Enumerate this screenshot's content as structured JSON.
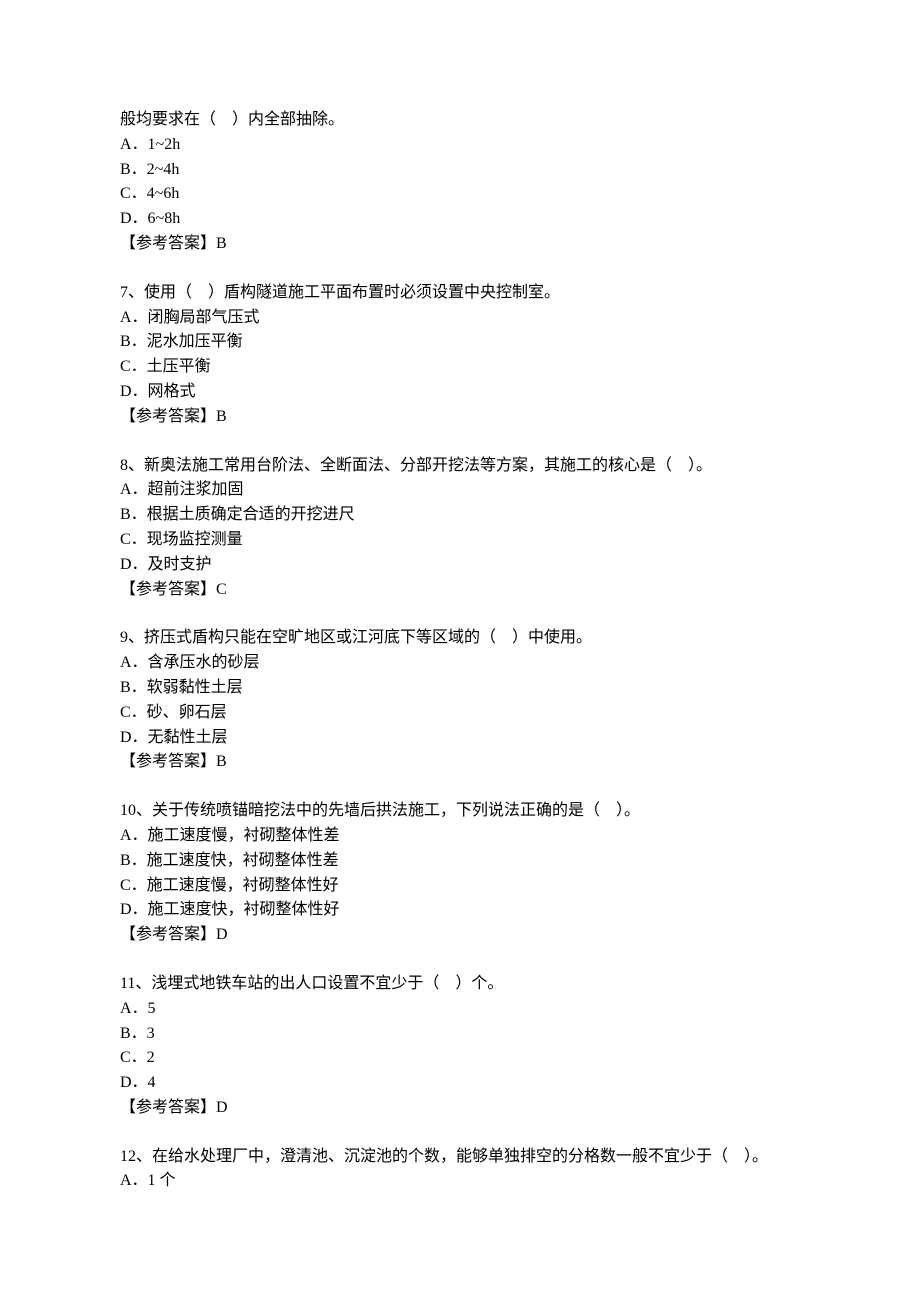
{
  "q6": {
    "stem": "般均要求在（　）内全部抽除。",
    "opts": [
      "A．1~2h",
      "B．2~4h",
      "C．4~6h",
      "D．6~8h"
    ],
    "answer": "【参考答案】B"
  },
  "q7": {
    "stem": "7、使用（　）盾构隧道施工平面布置时必须设置中央控制室。",
    "opts": [
      "A．闭胸局部气压式",
      "B．泥水加压平衡",
      "C．土压平衡",
      "D．网格式"
    ],
    "answer": "【参考答案】B"
  },
  "q8": {
    "stem": "8、新奥法施工常用台阶法、全断面法、分部开挖法等方案，其施工的核心是（　）。",
    "opts": [
      "A．超前注浆加固",
      "B．根据土质确定合适的开挖进尺",
      "C．现场监控测量",
      "D．及时支护"
    ],
    "answer": "【参考答案】C"
  },
  "q9": {
    "stem": "9、挤压式盾构只能在空旷地区或江河底下等区域的（　）中使用。",
    "opts": [
      "A．含承压水的砂层",
      "B．软弱黏性土层",
      "C．砂、卵石层",
      "D．无黏性土层"
    ],
    "answer": "【参考答案】B"
  },
  "q10": {
    "stem": "10、关于传统喷锚暗挖法中的先墙后拱法施工，下列说法正确的是（　）。",
    "opts": [
      "A．施工速度慢，衬砌整体性差",
      "B．施工速度快，衬砌整体性差",
      "C．施工速度慢，衬砌整体性好",
      "D．施工速度快，衬砌整体性好"
    ],
    "answer": "【参考答案】D"
  },
  "q11": {
    "stem": "11、浅埋式地铁车站的出人口设置不宜少于（　）个。",
    "opts": [
      "A．5",
      "B．3",
      "C．2",
      "D．4"
    ],
    "answer": "【参考答案】D"
  },
  "q12": {
    "stem": "12、在给水处理厂中，澄清池、沉淀池的个数，能够单独排空的分格数一般不宜少于（　）。",
    "opts": [
      "A．1 个"
    ],
    "answer": ""
  }
}
